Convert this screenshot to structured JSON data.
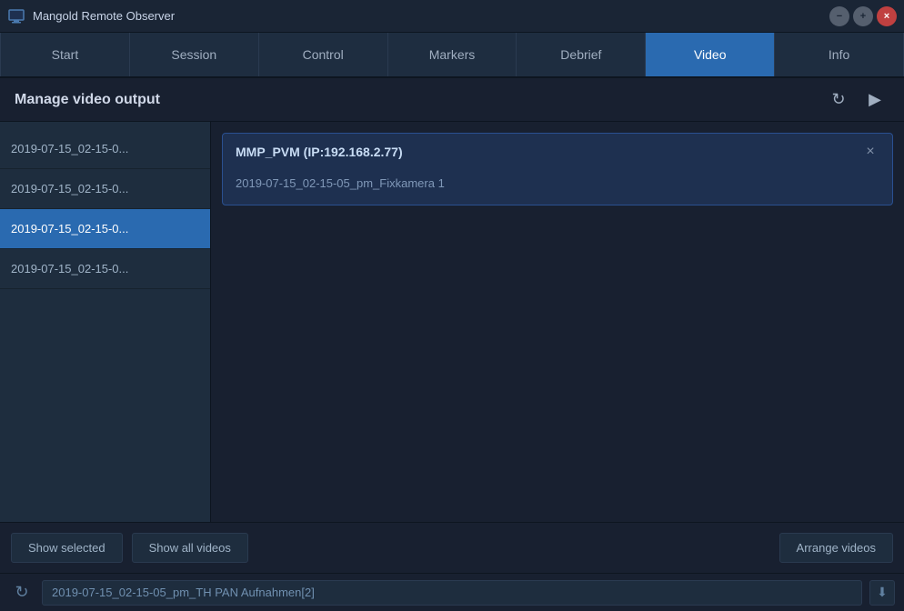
{
  "app": {
    "title": "Mangold Remote Observer",
    "icon": "monitor-icon"
  },
  "window_controls": {
    "minimize": "−",
    "maximize": "+",
    "close": "×"
  },
  "tabs": [
    {
      "id": "start",
      "label": "Start",
      "active": false
    },
    {
      "id": "session",
      "label": "Session",
      "active": false
    },
    {
      "id": "control",
      "label": "Control",
      "active": false
    },
    {
      "id": "markers",
      "label": "Markers",
      "active": false
    },
    {
      "id": "debrief",
      "label": "Debrief",
      "active": false
    },
    {
      "id": "video",
      "label": "Video",
      "active": true
    },
    {
      "id": "info",
      "label": "Info",
      "active": false
    }
  ],
  "header": {
    "title": "Manage video output",
    "refresh_label": "↻",
    "play_label": "▶"
  },
  "video_list": {
    "items": [
      {
        "id": 1,
        "label": "2019-07-15_02-15-0...",
        "selected": false
      },
      {
        "id": 2,
        "label": "2019-07-15_02-15-0...",
        "selected": false
      },
      {
        "id": 3,
        "label": "2019-07-15_02-15-0...",
        "selected": true
      },
      {
        "id": 4,
        "label": "2019-07-15_02-15-0...",
        "selected": false
      }
    ]
  },
  "video_detail": {
    "entries": [
      {
        "id": 1,
        "title": "MMP_PVM (IP:192.168.2.77)",
        "file": "2019-07-15_02-15-05_pm_Fixkamera 1",
        "close_label": "×"
      }
    ]
  },
  "bottom_bar": {
    "show_selected_label": "Show selected",
    "show_all_label": "Show all videos",
    "arrange_label": "Arrange videos"
  },
  "status_bar": {
    "refresh_label": "↻",
    "text": "2019-07-15_02-15-05_pm_TH PAN Aufnahmen[2]",
    "arrow_label": "⬇"
  }
}
